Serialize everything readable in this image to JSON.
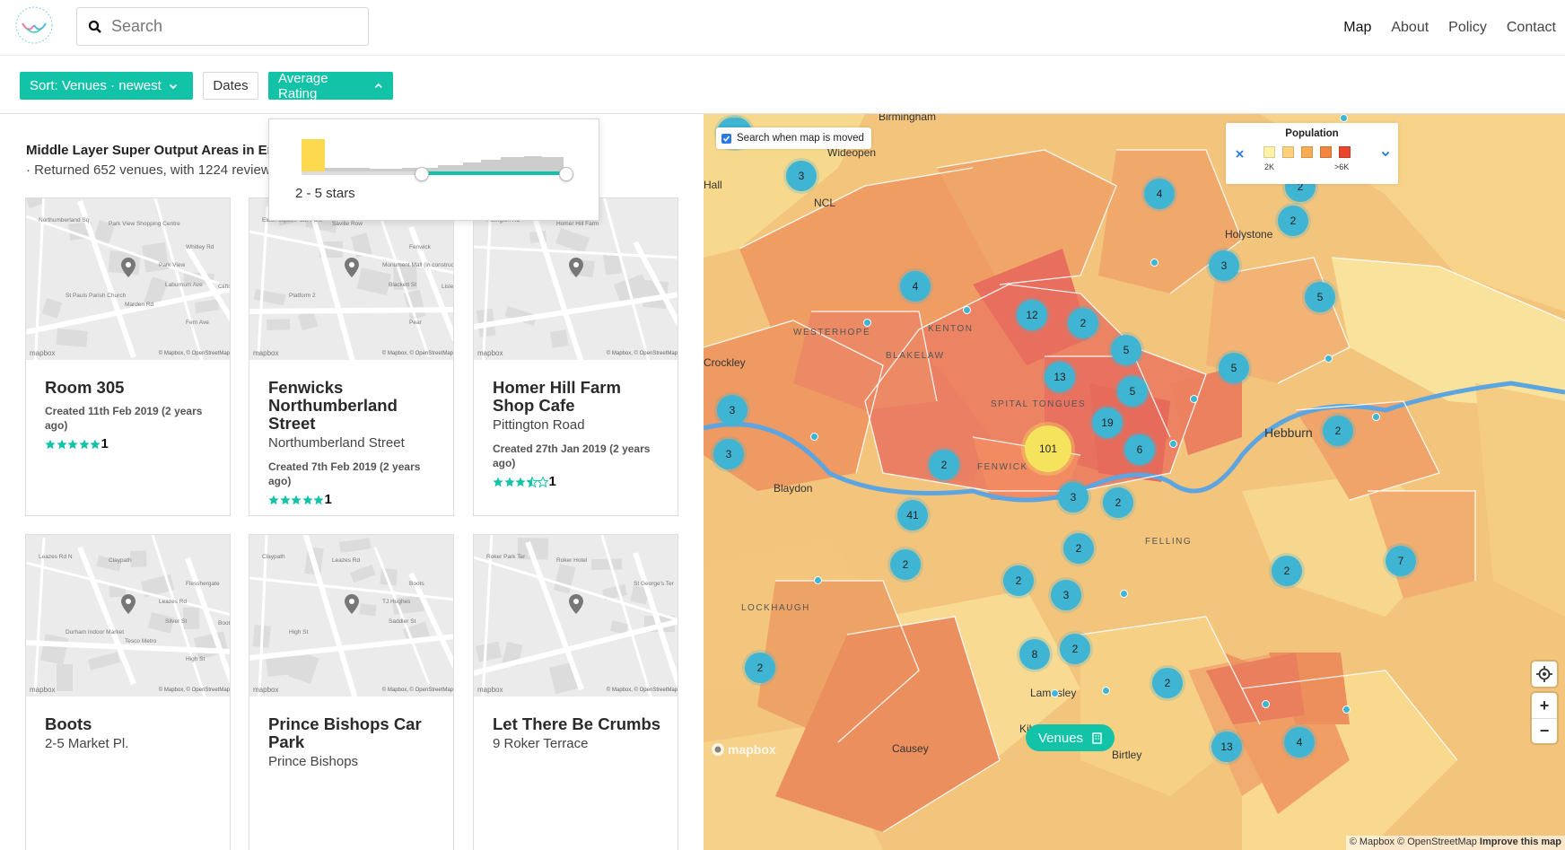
{
  "header": {
    "search_placeholder": "Search",
    "nav": [
      "Map",
      "About",
      "Policy",
      "Contact"
    ]
  },
  "filters": {
    "sort_label": "Sort: Venues · newest",
    "dates_label": "Dates",
    "rating_label": "Average Rating"
  },
  "rating_popup": {
    "range_label": "2 - 5 stars",
    "range_min": 2,
    "range_max": 5
  },
  "results": {
    "title": "Middle Layer Super Output Areas in Eng",
    "summary": "· Returned 652 venues, with 1224 review"
  },
  "venues": [
    {
      "name": "Room 305",
      "address": "",
      "created": "Created 11th Feb 2019 (2 years ago)",
      "rating": 5,
      "reviews": "1",
      "map_labels": [
        "Northumberland Sq",
        "Park View Shopping Centre",
        "Whitley Rd",
        "Park View",
        "St Pauls Parish Church",
        "Laburnum Ave",
        "Clifton Ter",
        "Fern Ave",
        "Marden Rd"
      ]
    },
    {
      "name": "Fenwicks Northumberland Street",
      "address": "Northumberland Street",
      "created": "Created 7th Feb 2019 (2 years ago)",
      "rating": 5,
      "reviews": "1",
      "map_labels": [
        "Eldon Square Car Park",
        "Saville Row",
        "Fenwick",
        "Monument Mall (in construction)",
        "Platform 2",
        "Blackett St",
        "Lisle St",
        "Pear"
      ]
    },
    {
      "name": "Homer Hill Farm Shop Cafe",
      "address": "Pittington Road",
      "created": "Created 27th Jan 2019 (2 years ago)",
      "rating": 3.5,
      "reviews": "1",
      "map_labels": [
        "Pittington Rd",
        "Homer Hill Farm"
      ]
    },
    {
      "name": "Boots",
      "address": "2-5 Market Pl.",
      "created": "",
      "rating": 0,
      "reviews": "",
      "map_labels": [
        "Leazes Rd N",
        "Claypath",
        "Flesshergate",
        "Leazes Rd",
        "Durham Indoor Market",
        "Silver St",
        "Boots",
        "High St",
        "Tesco Metro"
      ]
    },
    {
      "name": "Prince Bishops Car Park",
      "address": "Prince Bishops",
      "created": "",
      "rating": 0,
      "reviews": "",
      "map_labels": [
        "Claypath",
        "Leazes Rd",
        "Boots",
        "TJ Hughes",
        "High St",
        "Saddler St"
      ]
    },
    {
      "name": "Let There Be Crumbs",
      "address": "9 Roker Terrace",
      "created": "",
      "rating": 0,
      "reviews": "",
      "map_labels": [
        "Roker Park Ter",
        "Roker Hotel",
        "St George's Ter"
      ]
    }
  ],
  "map": {
    "search_when_moved": "Search when map is moved",
    "legend_title": "Population",
    "legend_low": "2K",
    "legend_high": ">6K",
    "legend_colors": [
      "#fdf3a8",
      "#fdd27a",
      "#f8ad55",
      "#f28640",
      "#e8462c"
    ],
    "venues_button": "Venues",
    "attribution": "© Mapbox © OpenStreetMap",
    "improve": "Improve this map",
    "mapbox_logo": "mapbox",
    "mini_map_logo": "mapbox",
    "mini_attribution": "© Mapbox, © OpenStreetMap",
    "places": [
      {
        "label": "Wideopen",
        "caps": false
      },
      {
        "label": "NCL",
        "caps": false
      },
      {
        "label": "Holystone",
        "caps": false
      },
      {
        "label": "WESTERHOPE",
        "caps": true
      },
      {
        "label": "KENTON",
        "caps": true
      },
      {
        "label": "BLAKELAW",
        "caps": true
      },
      {
        "label": "SPITAL TONGUES",
        "caps": true
      },
      {
        "label": "FENWICK",
        "caps": true
      },
      {
        "label": "Hebburn",
        "caps": false
      },
      {
        "label": "Blaydon",
        "caps": false
      },
      {
        "label": "FELLING",
        "caps": true
      },
      {
        "label": "LOCKHAUGH",
        "caps": true
      },
      {
        "label": "Lamesley",
        "caps": false
      },
      {
        "label": "Kibblesworth",
        "caps": false
      },
      {
        "label": "Causey",
        "caps": false
      },
      {
        "label": "Birtley",
        "caps": false
      },
      {
        "label": "Hall",
        "caps": false
      },
      {
        "label": "Crockley",
        "caps": false
      },
      {
        "label": "Birmingham",
        "caps": false
      }
    ],
    "clusters": [
      "3",
      "4",
      "2",
      "2",
      "3",
      "4",
      "12",
      "2",
      "5",
      "5",
      "13",
      "5",
      "19",
      "6",
      "5",
      "101",
      "2",
      "3",
      "3",
      "2",
      "2",
      "41",
      "3",
      "2",
      "2",
      "2",
      "2",
      "3",
      "2",
      "8",
      "2",
      "2",
      "2",
      "13",
      "4",
      "7",
      "3"
    ]
  }
}
